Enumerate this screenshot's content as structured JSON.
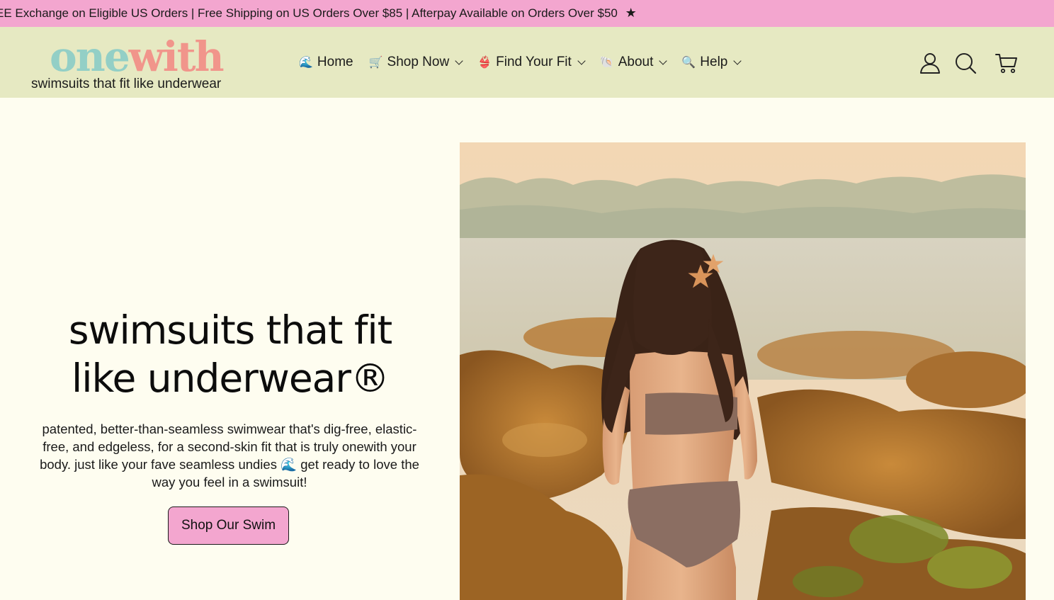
{
  "announcement": {
    "text": "EE Exchange on Eligible US Orders | Free Shipping on US Orders Over $85 | Afterpay Available on Orders Over $50",
    "star": "★"
  },
  "brand": {
    "logo_part1": "one",
    "logo_part2": "with",
    "tagline": "swimsuits that fit like underwear"
  },
  "nav": {
    "items": [
      {
        "emoji": "🌊",
        "label": "Home"
      },
      {
        "emoji": "🛒",
        "label": "Shop Now"
      },
      {
        "emoji": "👙",
        "label": "Find Your Fit"
      },
      {
        "emoji": "🐚",
        "label": "About"
      },
      {
        "emoji": "🔍",
        "label": "Help"
      }
    ]
  },
  "header_icons": [
    "account-icon",
    "search-icon",
    "cart-icon"
  ],
  "hero": {
    "title_line1": "swimsuits that fit",
    "title_line2": "like underwear®",
    "description": "patented, better-than-seamless swimwear that's dig-free, elastic-free, and edgeless, for a second-skin fit that is truly onewith your body. just like your fave seamless undies 🌊 get ready to love the way you feel in a swimsuit!",
    "cta_label": "Shop Our Swim"
  },
  "colors": {
    "announce_bg": "#f3a6cf",
    "header_bg": "#e6e9c2",
    "page_bg": "#fefdf0",
    "logo_one": "#93cfc6",
    "logo_with": "#f1958b",
    "cta_bg": "#f3a6cf"
  }
}
